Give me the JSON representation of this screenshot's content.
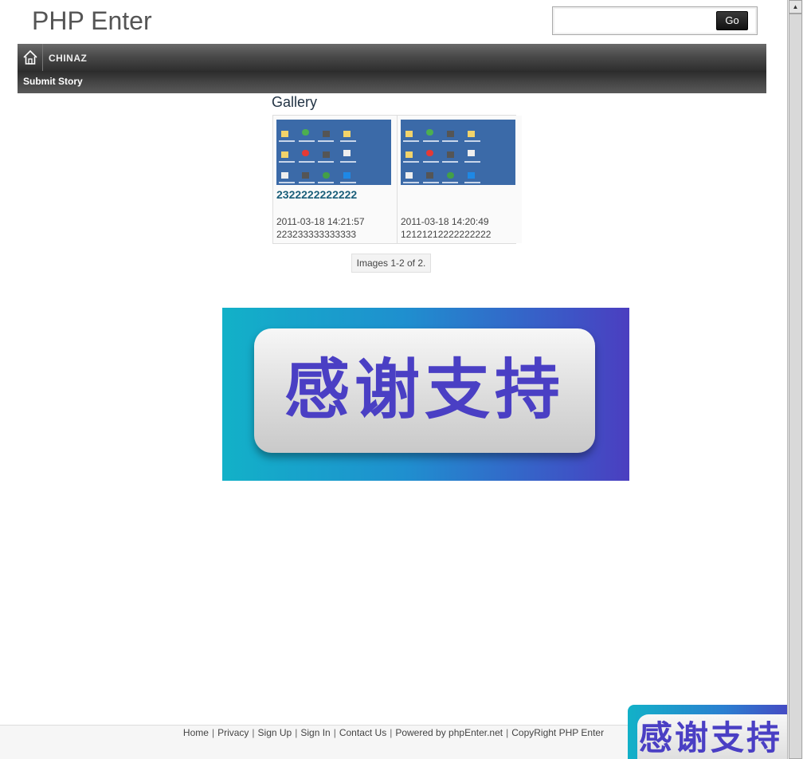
{
  "header": {
    "site_title": "PHP Enter",
    "search": {
      "value": "",
      "placeholder": "",
      "button_label": "Go"
    }
  },
  "nav": {
    "home_icon": "home-icon",
    "items": [
      {
        "label": "CHINAZ"
      }
    ],
    "sub_items": [
      {
        "label": "Submit Story"
      }
    ]
  },
  "gallery": {
    "heading": "Gallery",
    "items": [
      {
        "title": "2322222222222",
        "date": "2011-03-18 14:21:57",
        "description": "223233333333333"
      },
      {
        "title": "",
        "date": "2011-03-18 14:20:49",
        "description": "12121212222222222"
      }
    ],
    "pager_text": "Images 1-2 of 2."
  },
  "banner": {
    "text": "感谢支持",
    "colors": {
      "left": "#12b1c8",
      "right": "#4b3ec0",
      "text": "#4a3fc4"
    }
  },
  "footer": {
    "links": [
      {
        "label": "Home"
      },
      {
        "label": "Privacy"
      },
      {
        "label": "Sign Up"
      },
      {
        "label": "Sign In"
      },
      {
        "label": "Contact Us"
      }
    ],
    "powered_prefix": "Powered by",
    "powered_link": "phpEnter.net",
    "copyright": "CopyRight PHP Enter"
  },
  "float_banner": {
    "text": "感谢支持"
  }
}
